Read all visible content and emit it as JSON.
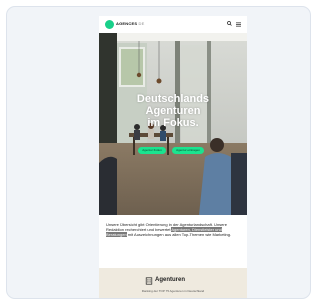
{
  "header": {
    "brand": "AGENCES",
    "brand_suffix": "DE",
    "logo_icon": "brand-logo-icon",
    "search_icon": "search-icon",
    "menu_icon": "hamburger-menu-icon"
  },
  "hero": {
    "title_lines": [
      "Deutschlands",
      "Agenturen",
      "im Fokus."
    ],
    "primary_button": "Agentur finden",
    "secondary_button": "Agentur eintragen"
  },
  "intro": {
    "before": "Unsere Übersicht gibt Orientierung in der Agenturlandschaft. Unsere Redaktion recherchiert und bewertet ",
    "highlight": "Agenturen, Dienstleister und Beratungen",
    "after": " mit Auszeichnungen aus allen Top-Themen wie Marketing."
  },
  "footer": {
    "icon": "building-icon",
    "title": "Agenturen",
    "subtitle": "Ranking der TOP 75 Agenturen in Deutschland"
  },
  "colors": {
    "accent": "#1be38f",
    "footer_band": "#efeadf",
    "frame": "#f1f4f8"
  }
}
